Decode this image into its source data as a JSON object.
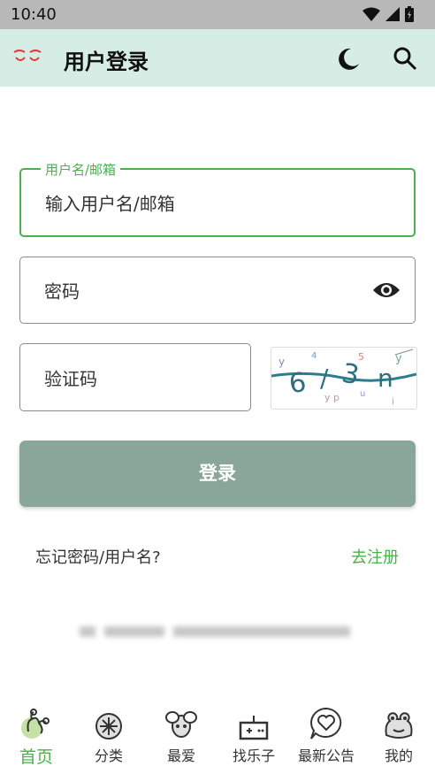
{
  "status_bar": {
    "time": "10:40"
  },
  "app_bar": {
    "title": "用户登录"
  },
  "form": {
    "username": {
      "label": "用户名/邮箱",
      "placeholder": "输入用户名/邮箱"
    },
    "password": {
      "placeholder": "密码"
    },
    "captcha": {
      "placeholder": "验证码"
    },
    "login_label": "登录"
  },
  "links": {
    "forgot": "忘记密码/用户名?",
    "register": "去注册"
  },
  "bottom_nav": [
    {
      "label": "首页",
      "icon": "home-frog-icon",
      "active": true
    },
    {
      "label": "分类",
      "icon": "category-icon",
      "active": false
    },
    {
      "label": "最爱",
      "icon": "favorite-bug-icon",
      "active": false
    },
    {
      "label": "找乐子",
      "icon": "gamepad-icon",
      "active": false
    },
    {
      "label": "最新公告",
      "icon": "announcement-heart-icon",
      "active": false
    },
    {
      "label": "我的",
      "icon": "profile-frog-icon",
      "active": false
    }
  ],
  "colors": {
    "accent": "#4caf50",
    "appbar": "#d6ede5",
    "button": "#8aa699"
  }
}
